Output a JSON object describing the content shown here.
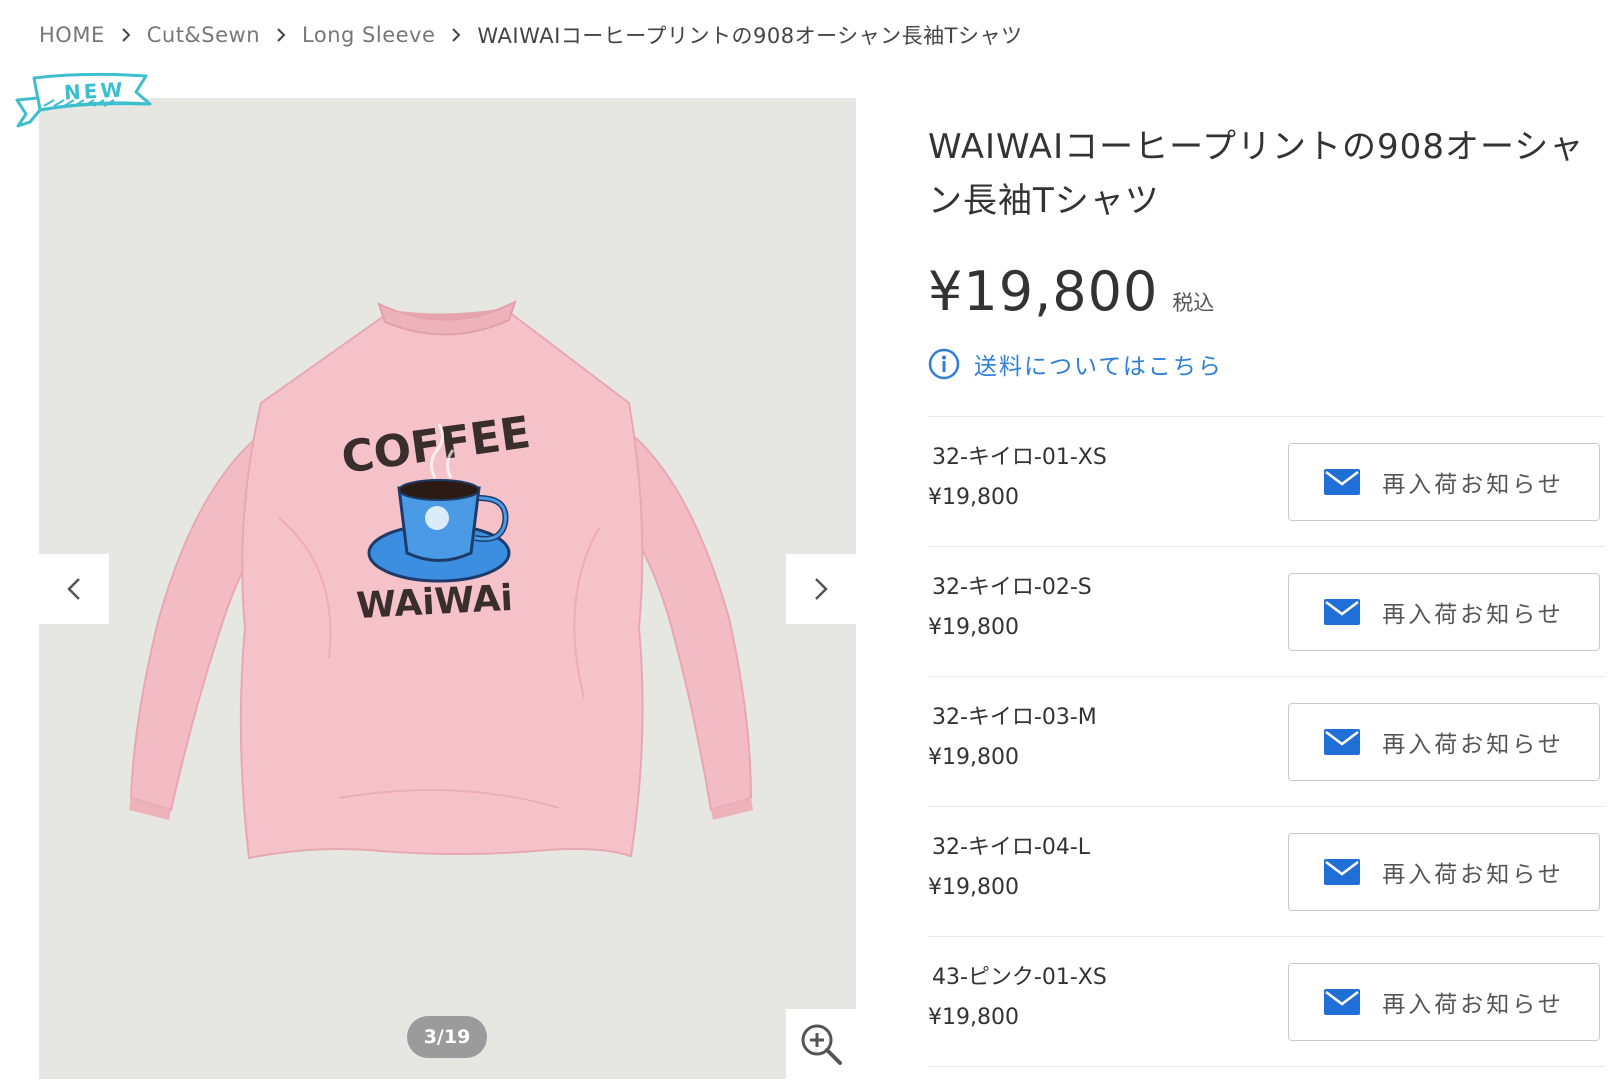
{
  "breadcrumb": {
    "items": [
      "HOME",
      "Cut&Sewn",
      "Long Sleeve",
      "WAIWAIコーヒープリントの908オーシャン長袖Tシャツ"
    ]
  },
  "badge": {
    "label": "NEW"
  },
  "gallery": {
    "counter": "3/19",
    "shirt_print": {
      "line1": "COFFEE",
      "line2": "WAiWAi"
    }
  },
  "product": {
    "title": "WAIWAIコーヒープリントの908オーシャン長袖Tシャツ",
    "price": "¥19,800",
    "tax_label": "税込",
    "shipping_link": "送料についてはこちら"
  },
  "variants": [
    {
      "name": "32-キイロ-01-XS",
      "price": "¥19,800",
      "button": "再入荷お知らせ"
    },
    {
      "name": "32-キイロ-02-S",
      "price": "¥19,800",
      "button": "再入荷お知らせ"
    },
    {
      "name": "32-キイロ-03-M",
      "price": "¥19,800",
      "button": "再入荷お知らせ"
    },
    {
      "name": "32-キイロ-04-L",
      "price": "¥19,800",
      "button": "再入荷お知らせ"
    },
    {
      "name": "43-ピンク-01-XS",
      "price": "¥19,800",
      "button": "再入荷お知らせ"
    }
  ],
  "colors": {
    "link_blue": "#2f7fd8",
    "mail_blue": "#1f6fd6",
    "ribbon_teal": "#3dbfcf",
    "shirt_pink": "#f6c2c9",
    "gallery_bg": "#e6e6e3"
  }
}
